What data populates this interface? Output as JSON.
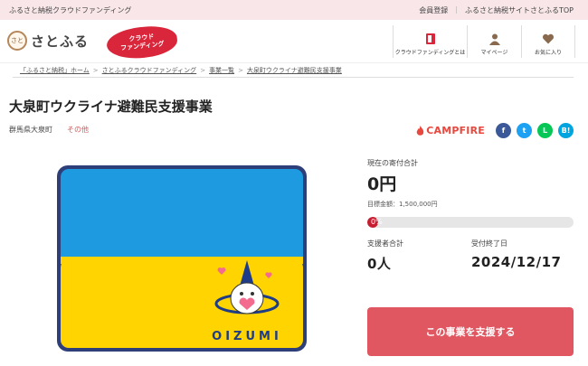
{
  "topbar": {
    "tagline": "ふるさと納税クラウドファンディング",
    "links": [
      "会員登録",
      "ふるさと納税サイトさとふるTOP"
    ]
  },
  "header": {
    "logo_mark": "さと",
    "logo_text": "さとふる",
    "badge_line1": "クラウド",
    "badge_line2": "ファンディング",
    "nav": [
      "クラウドファンディングとは",
      "マイページ",
      "お気に入り"
    ]
  },
  "breadcrumb": [
    "「ふるさと納税」ホーム",
    "さとふるクラウドファンディング",
    "事業一覧",
    "大泉町ウクライナ避難民支援事業"
  ],
  "project": {
    "title": "大泉町ウクライナ避難民支援事業",
    "region": "群馬県大泉町",
    "category": "その他",
    "hero_caption": "OIZUMI"
  },
  "share": {
    "campfire": "CAMPFIRE",
    "sns": [
      "f",
      "t",
      "L",
      "B!"
    ]
  },
  "stats": {
    "current_label": "現在の寄付合計",
    "current_amount": "0円",
    "goal": "目標金額：1,500,000円",
    "progress_label": "0%",
    "progress_fraction": 0,
    "supporters_label": "支援者合計",
    "supporters": "0人",
    "deadline_label": "受付終了日",
    "deadline": "2024/12/17"
  },
  "cta": {
    "label": "この事業を支援する"
  },
  "colors": {
    "topbar_bg": "#f8e6e8",
    "accent": "#d9263b",
    "cta": "#e05762",
    "flag_blue": "#1e9ae0",
    "flag_yellow": "#ffd400"
  }
}
